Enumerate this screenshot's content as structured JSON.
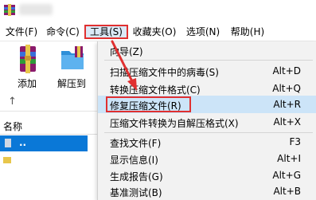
{
  "menubar": {
    "items": [
      {
        "label": "文件(F)"
      },
      {
        "label": "命令(C)"
      },
      {
        "label": "工具(S)"
      },
      {
        "label": "收藏夹(O)"
      },
      {
        "label": "选项(N)"
      },
      {
        "label": "帮助(H)"
      }
    ]
  },
  "toolbar": {
    "add_label": "添加",
    "extract_label": "解压到"
  },
  "filelist": {
    "column_name": "名称",
    "selected_row": ".."
  },
  "tools_menu": {
    "items": [
      {
        "label": "向导(Z)",
        "shortcut": ""
      },
      {
        "label": "扫描压缩文件中的病毒(S)",
        "shortcut": "Alt+D"
      },
      {
        "label": "转换压缩文件格式(C)",
        "shortcut": "Alt+Q"
      },
      {
        "label": "修复压缩文件(R)",
        "shortcut": "Alt+R"
      },
      {
        "label": "压缩文件转换为自解压格式(X)",
        "shortcut": "Alt+X"
      },
      {
        "label": "查找文件(F)",
        "shortcut": "F3"
      },
      {
        "label": "显示信息(I)",
        "shortcut": "Alt+I"
      },
      {
        "label": "生成报告(G)",
        "shortcut": "Alt+G"
      },
      {
        "label": "基准测试(B)",
        "shortcut": "Alt+B"
      }
    ],
    "highlighted_index": 3
  },
  "colors": {
    "highlight_border": "#e03030",
    "selection_blue": "#0a78d7",
    "menu_highlight": "#cce4f8"
  }
}
